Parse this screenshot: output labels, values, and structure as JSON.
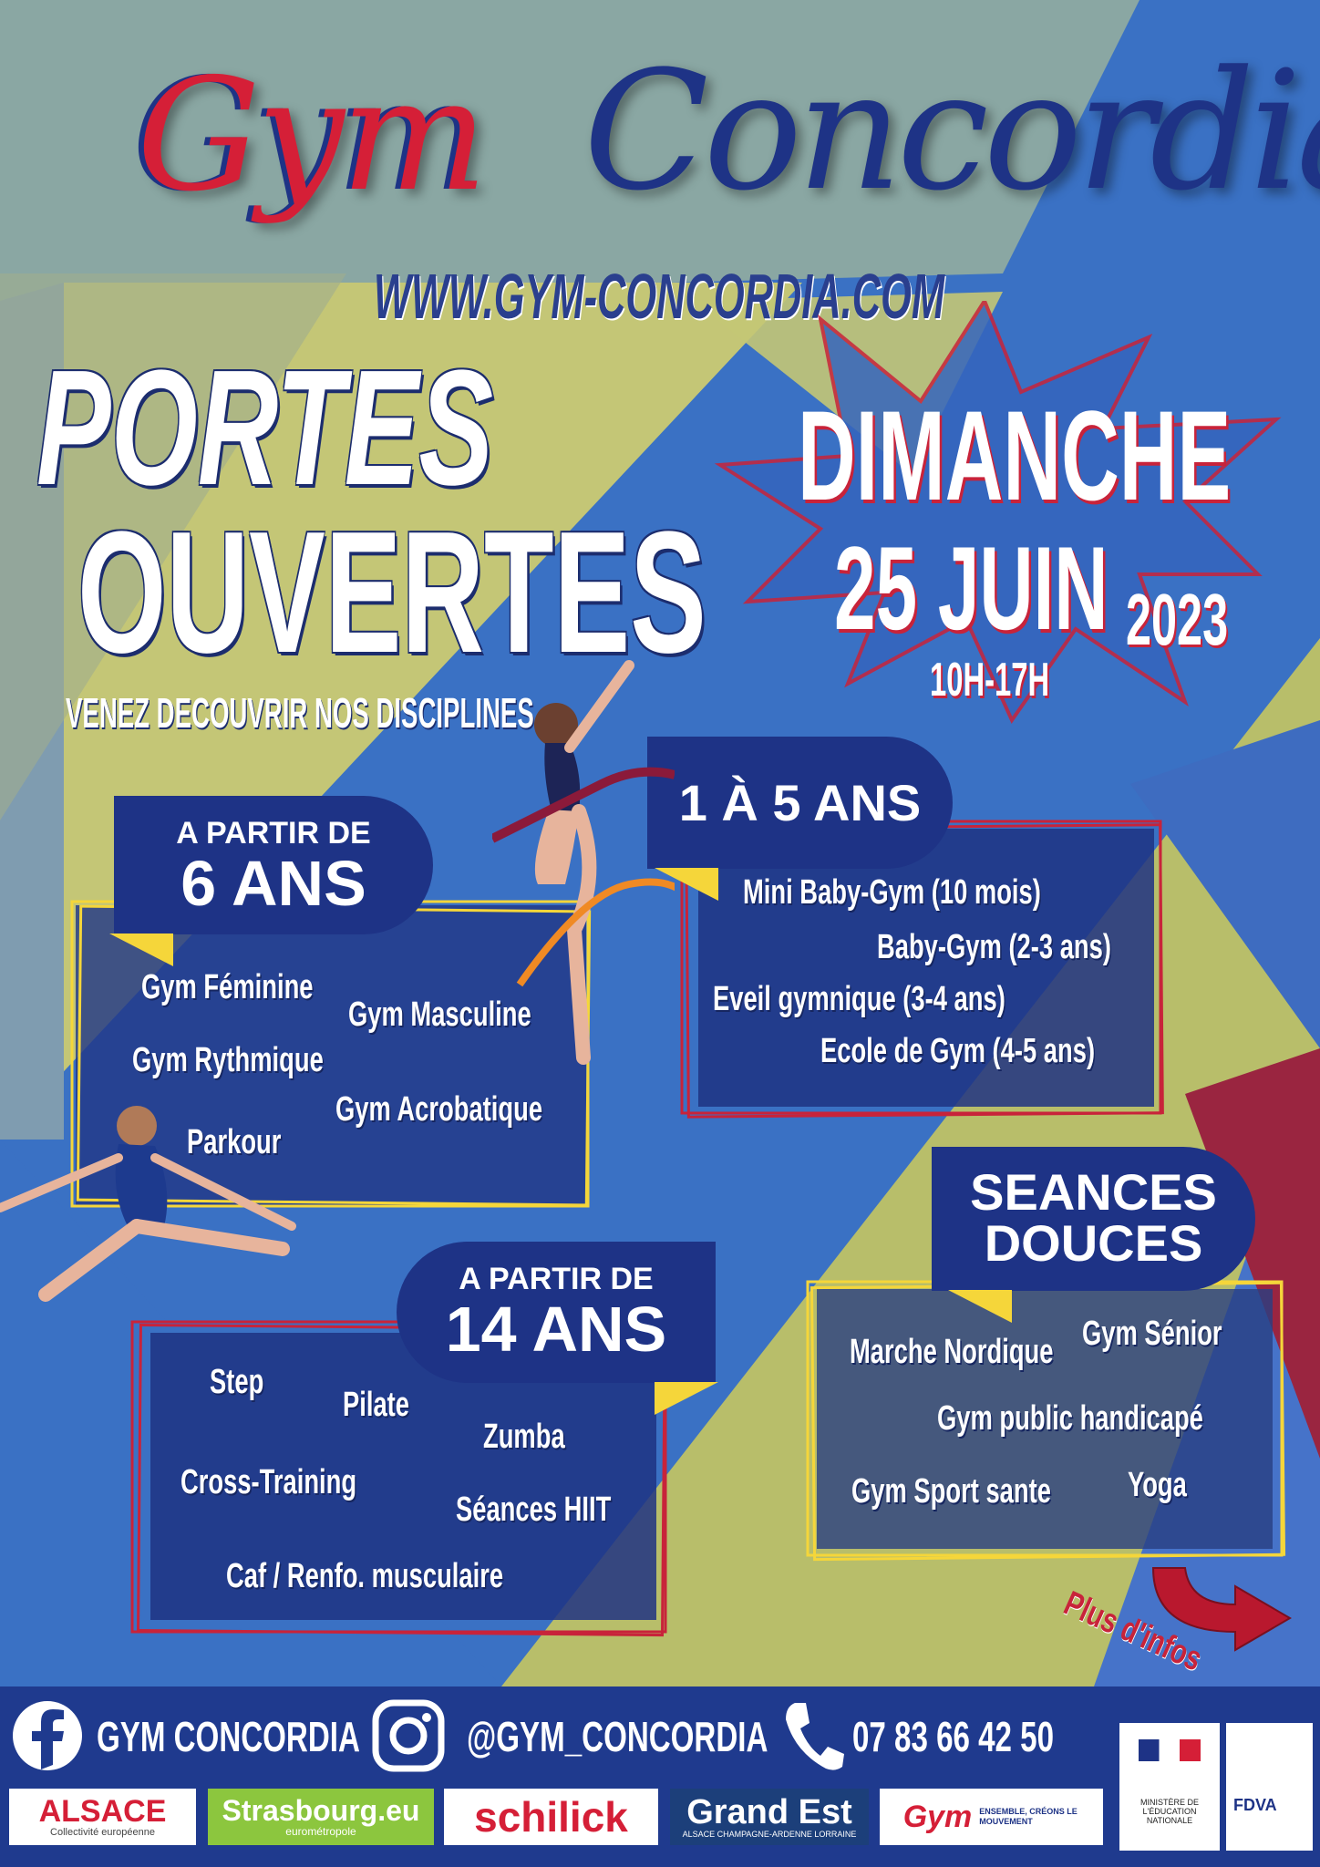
{
  "header": {
    "brand_part1": "Gym",
    "brand_part2": "Concordia",
    "website": "WWW.GYM-CONCORDIA.COM"
  },
  "headline": {
    "line1": "PORTES",
    "line2": "OUVERTES",
    "subtitle": "VENEZ DECOUVRIR NOS DISCIPLINES"
  },
  "date": {
    "day": "DIMANCHE",
    "date": "25 JUIN",
    "year": "2023",
    "hours": "10H-17H"
  },
  "section_6": {
    "label_line1": "A PARTIR DE",
    "label_line2": "6 ANS",
    "items": [
      "Gym Féminine",
      "Gym Masculine",
      "Gym Rythmique",
      "Gym Acrobatique",
      "Parkour"
    ]
  },
  "section_1_5": {
    "label": "1 À 5 ANS",
    "items": [
      "Mini Baby-Gym (10 mois)",
      "Baby-Gym (2-3 ans)",
      "Eveil gymnique (3-4 ans)",
      "Ecole de Gym (4-5 ans)"
    ]
  },
  "section_14": {
    "label_line1": "A PARTIR DE",
    "label_line2": "14 ANS",
    "items": [
      "Step",
      "Pilate",
      "Zumba",
      "Cross-Training",
      "Séances HIIT",
      "Caf / Renfo. musculaire"
    ]
  },
  "section_douces": {
    "label_line1": "SEANCES",
    "label_line2": "DOUCES",
    "items": [
      "Marche Nordique",
      "Gym Sénior",
      "Gym public handicapé",
      "Gym Sport sante",
      "Yoga"
    ]
  },
  "more_info": "Plus d'infos",
  "footer": {
    "facebook": "GYM CONCORDIA",
    "instagram": "@GYM_CONCORDIA",
    "phone": "07 83 66 42 50",
    "partners": [
      "ALSACE",
      "Collectivité européenne",
      "Strasbourg.eu",
      "eurométropole",
      "schilick",
      "Grand Est",
      "ALSACE CHAMPAGNE-ARDENNE LORRAINE",
      "Gym",
      "ENSEMBLE, CRÉONS LE MOUVEMENT",
      "MINISTÈRE DE L'ÉDUCATION NATIONALE",
      "FDVA"
    ]
  },
  "colors": {
    "background_blue": "#3a71c4",
    "navy": "#1e3386",
    "olive": "#c7c774",
    "red": "#c8233a",
    "yellow": "#f5d63a"
  },
  "icons": [
    "facebook-icon",
    "instagram-icon",
    "phone-icon",
    "arrow-icon"
  ]
}
